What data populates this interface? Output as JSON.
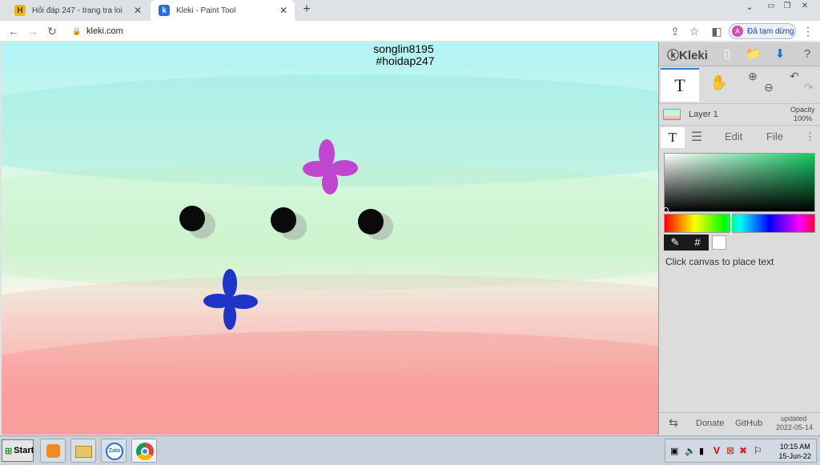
{
  "browser": {
    "tabs": [
      {
        "title": "Hỏi đáp 247 - trang tra loi",
        "favicon": "hoidap-icon"
      },
      {
        "title": "Kleki - Paint Tool",
        "favicon": "kleki-icon"
      }
    ],
    "url": "kleki.com",
    "profile_label": "Đã tạm dừng"
  },
  "canvas": {
    "text_line1": "songlin8195",
    "text_line2": "#hoidap247"
  },
  "panel": {
    "logo": "Kleki",
    "layer_name": "Layer 1",
    "opacity_label": "Opacity",
    "opacity_value": "100%",
    "tabs": {
      "edit": "Edit",
      "file": "File"
    },
    "hint": "Click canvas to place text",
    "footer": {
      "donate": "Donate",
      "github": "GitHub",
      "updated_label": "updated",
      "updated_date": "2022-05-14"
    }
  },
  "taskbar": {
    "start_label": "Start",
    "zalo_label": "Zalo",
    "time": "10:15 AM",
    "date": "15-Jun-22"
  }
}
